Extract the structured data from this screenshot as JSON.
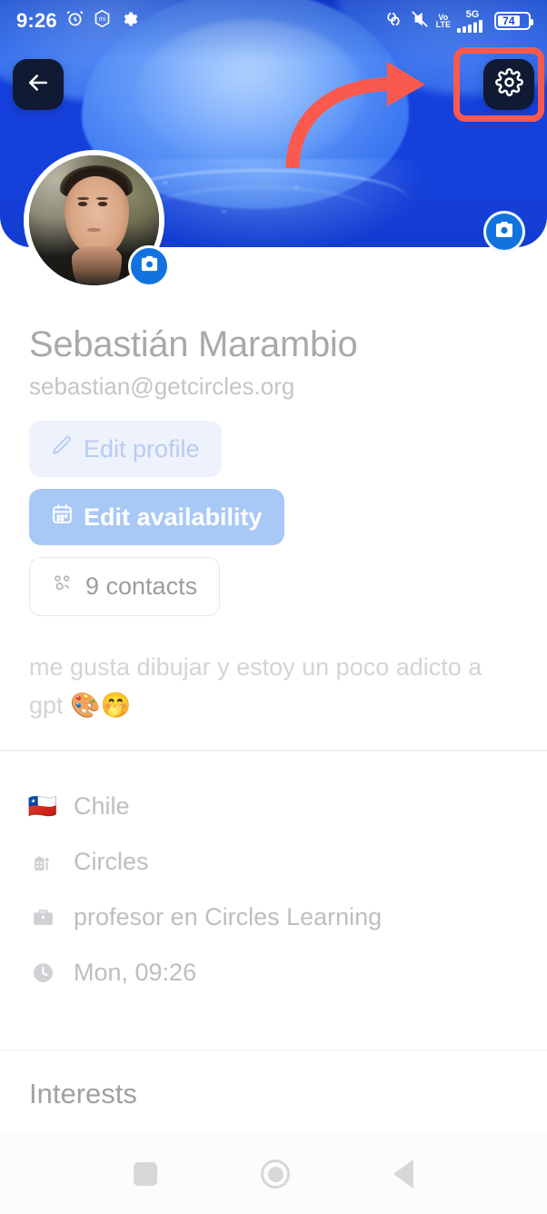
{
  "status_bar": {
    "time": "9:26",
    "battery_level": "74",
    "network_volte": "Vo LTE",
    "network_gen": "5G",
    "icons": [
      "alarm-icon",
      "miui-icon",
      "gear-icon",
      "nfc-icon",
      "mute-icon",
      "volte-icon",
      "5g-signal-icon",
      "battery-icon"
    ]
  },
  "top_nav": {
    "back_label": "back-arrow",
    "settings_label": "settings-gear"
  },
  "annotation": {
    "color": "#fa5a4e",
    "target": "settings-button"
  },
  "cover": {
    "camera_badge_label": "change-cover-photo"
  },
  "profile": {
    "name": "Sebastián Marambio",
    "email": "sebastian@getcircles.org",
    "avatar_camera_badge_label": "change-profile-photo",
    "bio": "me gusta dibujar y estoy un poco adicto a gpt 🎨🤭"
  },
  "actions": [
    {
      "id": "edit-profile",
      "label": "Edit profile",
      "icon": "pencil-icon",
      "style": "light"
    },
    {
      "id": "edit-availability",
      "label": "Edit availability",
      "icon": "calendar-icon",
      "style": "filled"
    },
    {
      "id": "contacts",
      "label": "9 contacts",
      "icon": "group-icon",
      "style": "outline"
    }
  ],
  "info_rows": [
    {
      "id": "country",
      "icon": "flag-chile-emoji",
      "emoji": "🇨🇱",
      "text": "Chile"
    },
    {
      "id": "organization",
      "icon": "building-icon",
      "text": "Circles"
    },
    {
      "id": "role",
      "icon": "briefcase-icon",
      "text": "profesor en Circles Learning"
    },
    {
      "id": "local-time",
      "icon": "clock-icon",
      "text": "Mon, 09:26"
    }
  ],
  "interests": {
    "title": "Interests",
    "chips": [
      "",
      ""
    ]
  },
  "android_nav": {
    "recents": "recents-square",
    "home": "home-circle",
    "back": "back-triangle"
  },
  "colors": {
    "cover_blue": "#1540db",
    "accent_blue": "#1273e0",
    "annotation_red": "#fa5a4e",
    "availability_blue": "#a8c9f5"
  }
}
